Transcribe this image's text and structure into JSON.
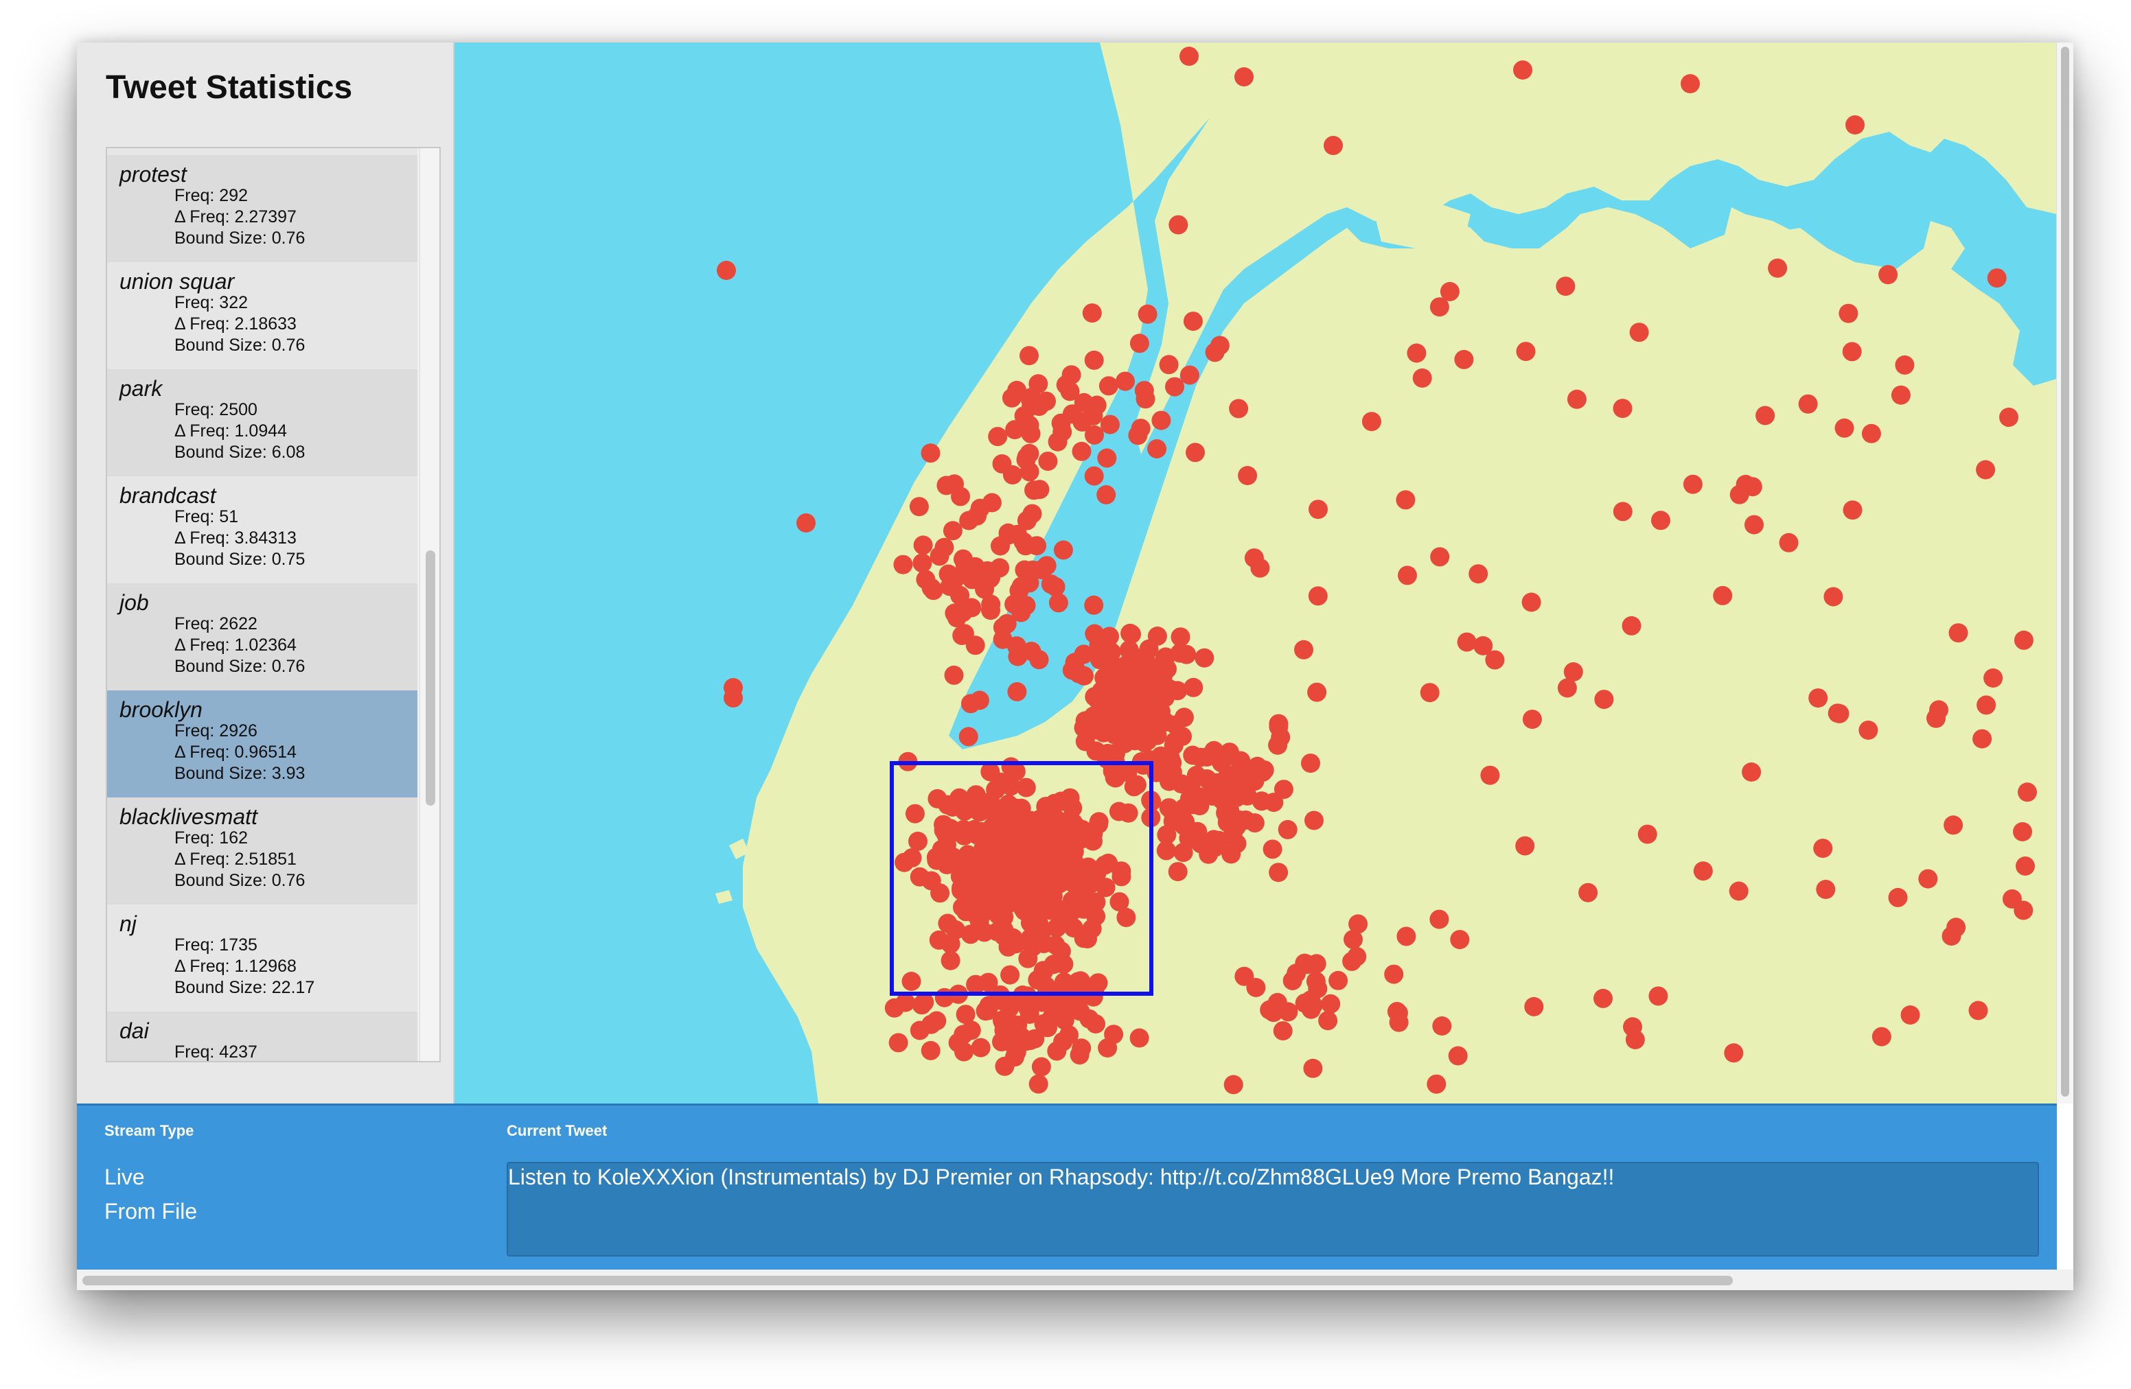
{
  "sidebar": {
    "title": "Tweet Statistics",
    "entries": [
      {
        "term": "",
        "freq": "",
        "dfreq": "",
        "bound": "Bound Size: 0.76"
      },
      {
        "term": "protest",
        "freq": "Freq: 292",
        "dfreq": "Δ Freq: 2.27397",
        "bound": "Bound Size: 0.76"
      },
      {
        "term": "union squar",
        "freq": "Freq: 322",
        "dfreq": "Δ Freq: 2.18633",
        "bound": "Bound Size: 0.76"
      },
      {
        "term": "park",
        "freq": "Freq: 2500",
        "dfreq": "Δ Freq: 1.0944",
        "bound": "Bound Size: 6.08"
      },
      {
        "term": "brandcast",
        "freq": "Freq: 51",
        "dfreq": "Δ Freq: 3.84313",
        "bound": "Bound Size: 0.75"
      },
      {
        "term": "job",
        "freq": "Freq: 2622",
        "dfreq": "Δ Freq: 1.02364",
        "bound": "Bound Size: 0.76"
      },
      {
        "term": "brooklyn",
        "freq": "Freq: 2926",
        "dfreq": "Δ Freq: 0.96514",
        "bound": "Bound Size: 3.93",
        "selected": true
      },
      {
        "term": "blacklivesmatt",
        "freq": "Freq: 162",
        "dfreq": "Δ Freq: 2.51851",
        "bound": "Bound Size: 0.76"
      },
      {
        "term": "nj",
        "freq": "Freq: 1735",
        "dfreq": "Δ Freq: 1.12968",
        "bound": "Bound Size: 22.17"
      },
      {
        "term": "dai",
        "freq": "Freq: 4237",
        "dfreq": "",
        "bound": ""
      }
    ]
  },
  "bottom": {
    "stream_type_label": "Stream Type",
    "stream_live": "Live",
    "stream_file": "From File",
    "current_tweet_label": "Current Tweet",
    "current_tweet": "Listen to KoleXXXion (Instrumentals) by DJ Premier on Rhapsody: http://t.co/Zhm88GLUe9 More Premo Bangaz!!"
  },
  "colors": {
    "water": "#6ad8ef",
    "land": "#e9f0b6",
    "tweet_dot": "#e8483a",
    "selection_box": "#1010ee",
    "selected_row": "#8fb0cc",
    "bottom_bar": "#3b96db"
  }
}
